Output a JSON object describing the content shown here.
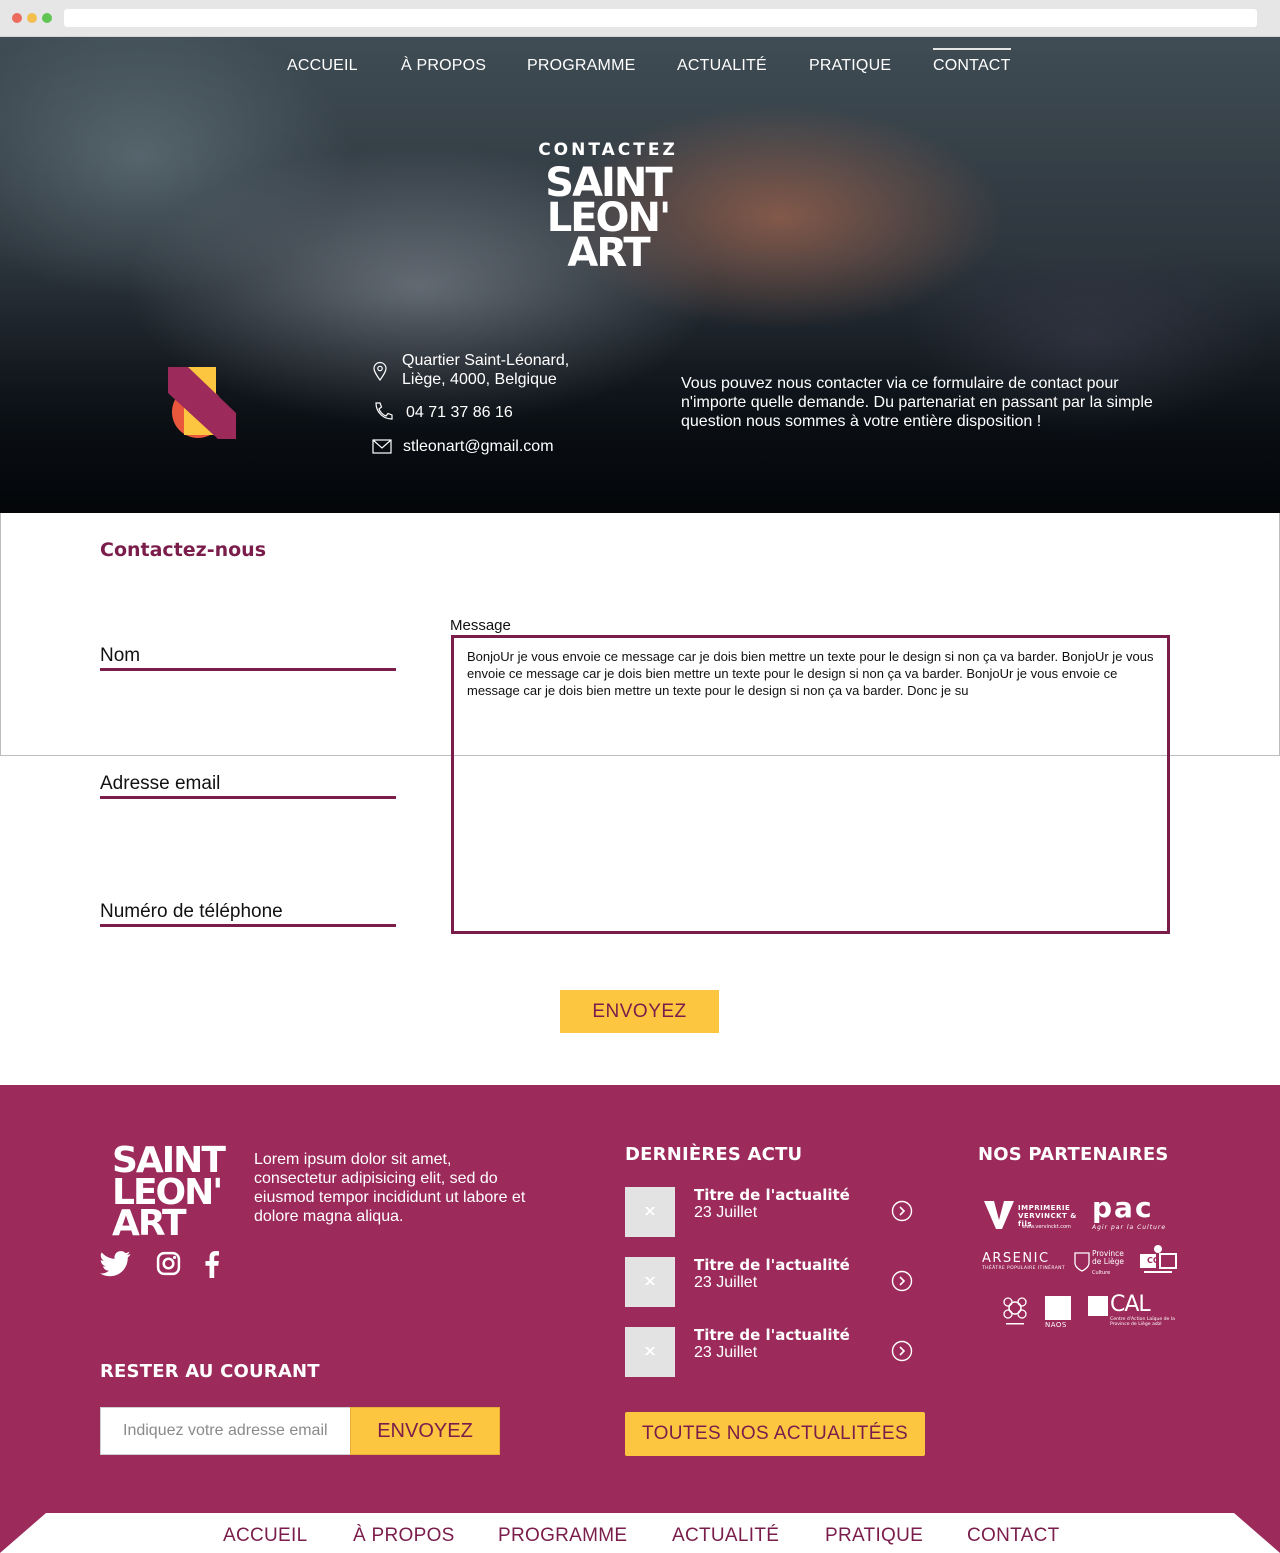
{
  "nav": {
    "items": [
      "ACCUEIL",
      "À PROPOS",
      "PROGRAMME",
      "ACTUALITÉ",
      "PRATIQUE",
      "CONTACT"
    ],
    "active": "CONTACT"
  },
  "hero": {
    "kicker": "CONTACTEZ",
    "logo_lines": [
      "SAINT",
      "LEON'",
      "ART"
    ],
    "address_line1": "Quartier Saint-Léonard,",
    "address_line2": "Liège, 4000, Belgique",
    "phone": "04 71 37 86 16",
    "email": "stleonart@gmail.com",
    "description": "Vous pouvez nous contacter via ce formulaire de contact pour n'importe quelle demande. Du partenariat en passant par la simple question nous sommes à votre entière disposition !"
  },
  "form": {
    "heading": "Contactez-nous",
    "name_placeholder": "Nom",
    "email_placeholder": "Adresse email",
    "phone_placeholder": "Numéro de téléphone",
    "message_label": "Message",
    "message_value": "BonjoUr je vous envoie ce message car je dois bien mettre un texte pour le design si non ça va barder. BonjoUr je vous envoie ce message car je dois bien mettre un texte pour le design si non ça va barder. BonjoUr je vous envoie ce message car je dois bien mettre un texte pour le design si non ça va barder. Donc je su",
    "submit_label": "ENVOYEZ"
  },
  "footer": {
    "logo_lines": [
      "SAINT",
      "LEON'",
      "ART"
    ],
    "lorem": "Lorem ipsum dolor sit amet, consectetur adipisicing elit, sed do eiusmod tempor incididunt ut labore et dolore magna aliqua.",
    "social_icons": [
      "twitter-icon",
      "instagram-icon",
      "facebook-icon"
    ],
    "newsletter_heading": "RESTER AU COURANT",
    "newsletter_placeholder": "Indiquez votre adresse email",
    "newsletter_button": "ENVOYEZ",
    "news_heading": "DERNIÈRES ACTU",
    "news": [
      {
        "title": "Titre de l'actualité",
        "date": "23 Juillet"
      },
      {
        "title": "Titre de l'actualité",
        "date": "23 Juillet"
      },
      {
        "title": "Titre de l'actualité",
        "date": "23 Juillet"
      }
    ],
    "all_news_button": "TOUTES NOS ACTUALITÉES",
    "partners_heading": "NOS PARTENAIRES",
    "partners": {
      "vp_name": "IMPRIMERIE VERVINCKT & fils",
      "vp_url": "www.vervinckt.com",
      "pac": "pac",
      "pac_tagline": "Agir par la Culture",
      "arsenic": "ARSENIC",
      "arsenic_sub": "THÉÂTRE POPULAIRE ITINÉRANT",
      "province": "Province de Liège",
      "province_sub": "Culture",
      "cc": "CC",
      "naos": "NAOS",
      "cal": "CAL",
      "cal_sub": "Centre d'Action Laïque de la Province de Liège asbl"
    }
  },
  "bottom_nav": {
    "items": [
      "ACCUEIL",
      "À PROPOS",
      "PROGRAMME",
      "ACTUALITÉ",
      "PRATIQUE",
      "CONTACT"
    ]
  },
  "colors": {
    "brand": "#9c2a5b",
    "brand_dark": "#7a1d4b",
    "accent": "#fdc641"
  }
}
